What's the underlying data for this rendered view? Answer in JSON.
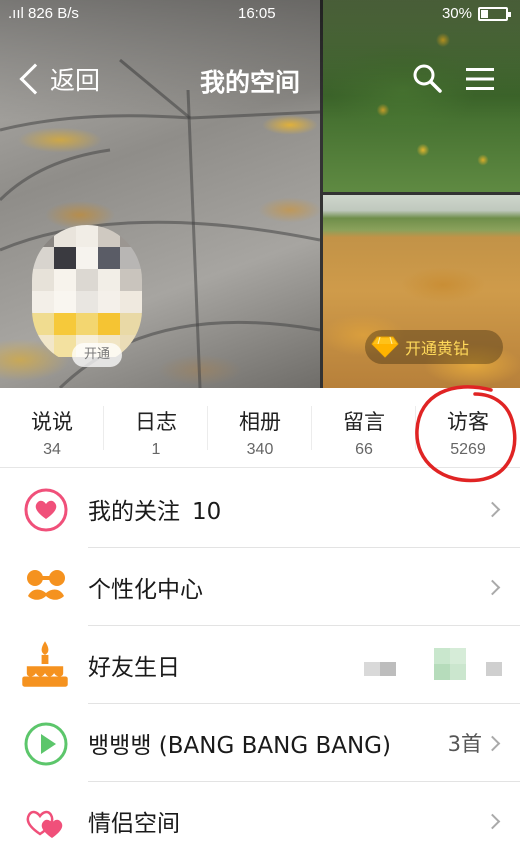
{
  "status_bar": {
    "left": ".ııl 826 B/s",
    "time": "16:05",
    "battery": "30%",
    "battery_level": 0.3
  },
  "nav": {
    "back_label": "返回",
    "title": "我的空间"
  },
  "hero": {
    "open_badge": "开通",
    "diamond_badge": "开通黄钻"
  },
  "stats": [
    {
      "label": "说说",
      "count": "34"
    },
    {
      "label": "日志",
      "count": "1"
    },
    {
      "label": "相册",
      "count": "340"
    },
    {
      "label": "留言",
      "count": "66"
    },
    {
      "label": "访客",
      "count": "5269"
    }
  ],
  "list": {
    "follow": {
      "label": "我的关注",
      "count": "10",
      "icon": "heart-icon"
    },
    "personalize": {
      "label": "个性化中心",
      "icon": "mustache-icon"
    },
    "birthday": {
      "label": "好友生日",
      "icon": "cake-icon"
    },
    "music": {
      "label": "뱅뱅뱅 (BANG BANG BANG)",
      "count": "3首",
      "icon": "play-icon"
    },
    "couple": {
      "label": "情侣空间",
      "icon": "double-heart-icon"
    }
  },
  "colors": {
    "heart_pink": "#f0507a",
    "orange": "#f5921f",
    "green": "#5cc66b",
    "annotation_red": "#e02424"
  }
}
